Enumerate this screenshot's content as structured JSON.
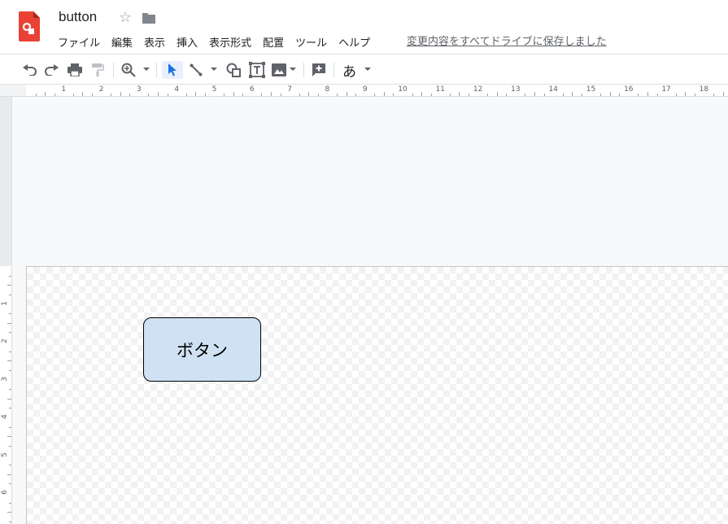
{
  "app": {
    "title": "button",
    "save_status": "変更内容をすべてドライブに保存しました",
    "accent_color": "#e94235"
  },
  "menu": {
    "items": [
      "ファイル",
      "編集",
      "表示",
      "挿入",
      "表示形式",
      "配置",
      "ツール",
      "ヘルプ"
    ]
  },
  "toolbar": {
    "icons": [
      "undo-icon",
      "redo-icon",
      "print-icon",
      "paint-format-icon",
      "zoom-icon",
      "select-icon",
      "line-icon",
      "shape-icon",
      "textbox-icon",
      "image-icon",
      "add-comment-icon"
    ],
    "text_style": "あ"
  },
  "rulers": {
    "horizontal": [
      "1",
      "2",
      "3",
      "4",
      "5",
      "6",
      "7",
      "8",
      "9",
      "10",
      "11",
      "12",
      "13",
      "14",
      "15",
      "16",
      "17",
      "18"
    ],
    "vertical": [
      "1",
      "2",
      "3",
      "4",
      "5",
      "6"
    ]
  },
  "canvas": {
    "shape": {
      "text": "ボタン",
      "fill_color": "#cfe2f3",
      "border_color": "#000000"
    }
  }
}
